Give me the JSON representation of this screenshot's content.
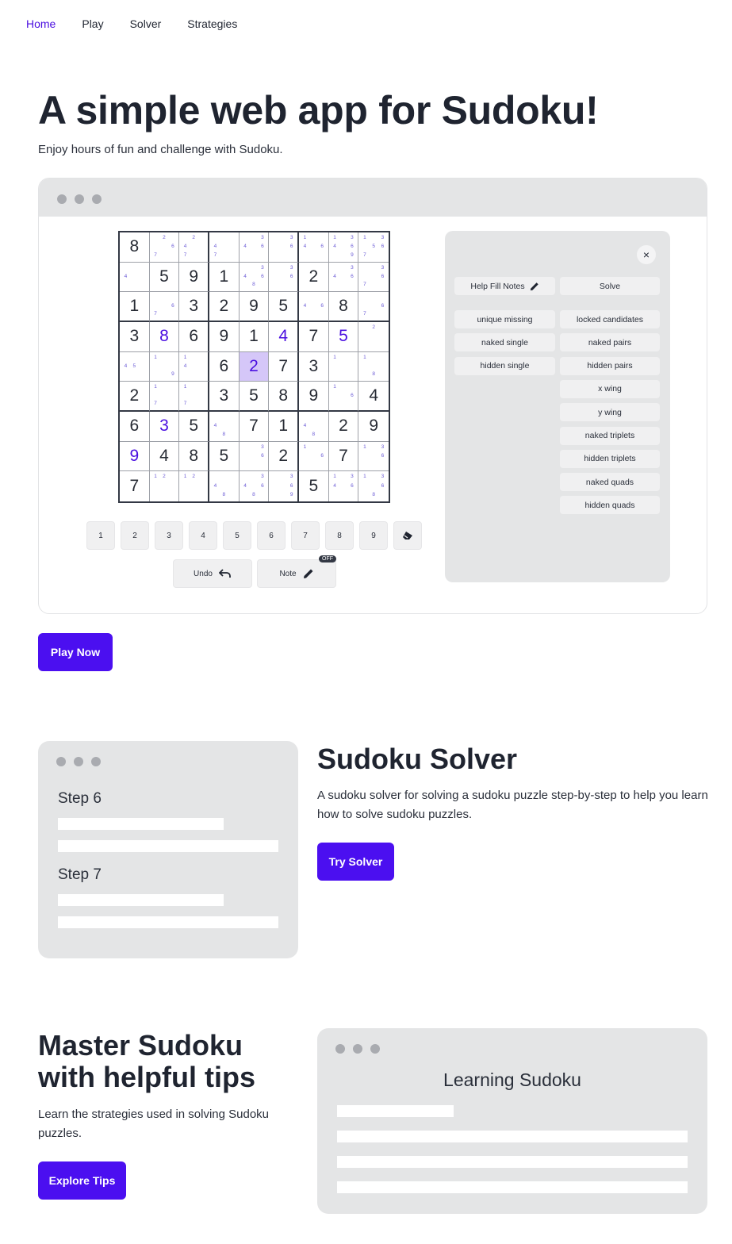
{
  "nav": {
    "items": [
      {
        "label": "Home",
        "active": true
      },
      {
        "label": "Play",
        "active": false
      },
      {
        "label": "Solver",
        "active": false
      },
      {
        "label": "Strategies",
        "active": false
      }
    ]
  },
  "hero": {
    "title": "A simple web app for Sudoku!",
    "subtitle": "Enjoy hours of fun and challenge with Sudoku."
  },
  "board": {
    "grid": [
      [
        "8",
        "",
        "",
        "",
        "",
        "",
        "",
        "",
        ""
      ],
      [
        "",
        "5",
        "9",
        "1",
        "",
        "",
        "2",
        "",
        ""
      ],
      [
        "1",
        "",
        "3",
        "2",
        "9",
        "5",
        "",
        "8",
        ""
      ],
      [
        "3",
        "8",
        "6",
        "9",
        "1",
        "4",
        "7",
        "5",
        ""
      ],
      [
        "",
        "",
        "",
        "6",
        "2",
        "7",
        "3",
        "",
        ""
      ],
      [
        "2",
        "",
        "",
        "3",
        "5",
        "8",
        "9",
        "",
        "4"
      ],
      [
        "6",
        "3",
        "5",
        "",
        "7",
        "1",
        "",
        "2",
        "9"
      ],
      [
        "9",
        "4",
        "8",
        "5",
        "",
        "2",
        "",
        "7",
        ""
      ],
      [
        "7",
        "",
        "",
        "",
        "",
        "",
        "5",
        "",
        ""
      ]
    ],
    "user_cells": [
      [
        3,
        1
      ],
      [
        3,
        5
      ],
      [
        3,
        7
      ],
      [
        6,
        1
      ],
      [
        7,
        0
      ],
      [
        4,
        4
      ]
    ],
    "selected": [
      4,
      4
    ],
    "notes": {
      "0,1": [
        "2",
        "6",
        "7"
      ],
      "0,2": [
        "2",
        "4",
        "7"
      ],
      "0,3": [
        "4",
        "7"
      ],
      "0,4": [
        "3",
        "4",
        "6"
      ],
      "0,5": [
        "3",
        "6"
      ],
      "0,6": [
        "1",
        "4",
        "6"
      ],
      "0,7": [
        "1",
        "3",
        "4",
        "6",
        "9"
      ],
      "0,8": [
        "1",
        "3",
        "5",
        "6",
        "7"
      ],
      "1,0": [
        "4"
      ],
      "1,4": [
        "3",
        "4",
        "6",
        "8"
      ],
      "1,5": [
        "3",
        "6"
      ],
      "1,7": [
        "3",
        "4",
        "6"
      ],
      "1,8": [
        "3",
        "6",
        "7"
      ],
      "2,1": [
        "6",
        "7"
      ],
      "2,6": [
        "4",
        "6"
      ],
      "2,8": [
        "6",
        "7"
      ],
      "3,8": [
        "2"
      ],
      "4,0": [
        "4",
        "5"
      ],
      "4,1": [
        "1",
        "9"
      ],
      "4,2": [
        "1",
        "4"
      ],
      "4,7": [
        "1"
      ],
      "4,8": [
        "1",
        "8"
      ],
      "5,1": [
        "1",
        "7"
      ],
      "5,2": [
        "1",
        "7"
      ],
      "5,7": [
        "1",
        "6"
      ],
      "6,3": [
        "4",
        "8"
      ],
      "6,6": [
        "4",
        "8"
      ],
      "7,4": [
        "3",
        "6"
      ],
      "7,6": [
        "1",
        "6"
      ],
      "7,8": [
        "1",
        "3",
        "6"
      ],
      "8,1": [
        "1",
        "2"
      ],
      "8,2": [
        "1",
        "2"
      ],
      "8,3": [
        "4",
        "8"
      ],
      "8,4": [
        "3",
        "4",
        "6",
        "8"
      ],
      "8,5": [
        "3",
        "6",
        "9"
      ],
      "8,7": [
        "1",
        "3",
        "4",
        "6"
      ],
      "8,8": [
        "1",
        "3",
        "6",
        "8"
      ]
    },
    "keypad": [
      "1",
      "2",
      "3",
      "4",
      "5",
      "6",
      "7",
      "8",
      "9"
    ],
    "undo_label": "Undo",
    "note_label": "Note",
    "note_state": "OFF"
  },
  "panel": {
    "close_icon": "×",
    "help_fill_label": "Help Fill Notes",
    "solve_label": "Solve",
    "left_strategies": [
      "unique missing",
      "naked single",
      "hidden single"
    ],
    "right_strategies": [
      "locked candidates",
      "naked pairs",
      "hidden pairs",
      "x wing",
      "y wing",
      "naked triplets",
      "hidden triplets",
      "naked quads",
      "hidden quads"
    ]
  },
  "play_now_label": "Play Now",
  "solver": {
    "steps": [
      "Step 6",
      "Step 7"
    ],
    "title": "Sudoku Solver",
    "text": "A sudoku solver for solving a sudoku puzzle step-by-step to help you learn how to solve sudoku puzzles.",
    "button": "Try Solver"
  },
  "tips": {
    "title": "Master Sudoku with helpful tips",
    "text": "Learn the strategies used in solving Sudoku puzzles.",
    "button": "Explore Tips",
    "card_title": "Learning Sudoku"
  },
  "colors": {
    "accent": "#4b0ff0",
    "selected_cell": "#d5c7f8",
    "card_bg": "#e4e5e6"
  }
}
